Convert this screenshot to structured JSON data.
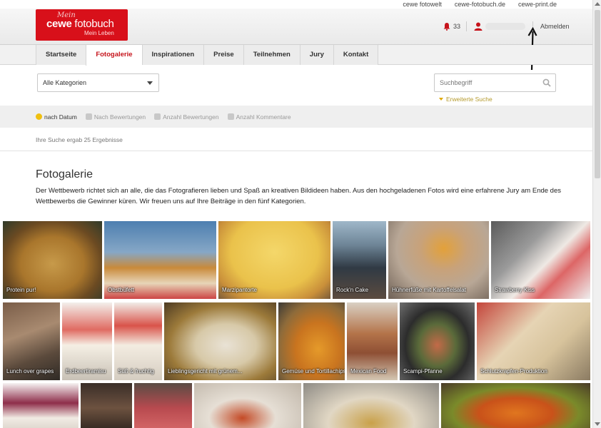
{
  "toplinks": [
    "cewe fotowelt",
    "cewe-fotobuch.de",
    "cewe-print.de"
  ],
  "logo": {
    "mein": "Mein",
    "brand_bold": "cewe",
    "brand_rest": "fotobuch",
    "sub": "Mein Leben"
  },
  "header": {
    "notification_count": "33",
    "logout": "Abmelden"
  },
  "nav": {
    "items": [
      "Startseite",
      "Fotogalerie",
      "Inspirationen",
      "Preise",
      "Teilnehmen",
      "Jury",
      "Kontakt"
    ],
    "active": "Fotogalerie"
  },
  "filter": {
    "category": "Alle Kategorien",
    "search_placeholder": "Suchbegriff",
    "advanced": "Erweiterte Suche"
  },
  "sort": [
    "nach Datum",
    "Nach Bewertungen",
    "Anzahl Bewertungen",
    "Anzahl Kommentare"
  ],
  "results_text": "Ihre Suche ergab 25 Ergebnisse",
  "page_title": "Fotogalerie",
  "intro": "Der Wettbewerb richtet sich an alle, die das Fotografieren lieben und Spaß an kreativen Bildideen haben. Aus den hochgeladenen Fotos wird eine erfahrene Jury am Ende des Wettbewerbs die Gewinner küren. Wir freuen uns auf Ihre Beiträge in den fünf Kategorien.",
  "gallery": {
    "row1": [
      "Protein pur!",
      "Obstbüfett",
      "Marzipantorte",
      "Rock'n Cake",
      "Hühnerfüße mit Kartoffelsalat",
      "Strawberry Kiss"
    ],
    "row2": [
      "Lunch over grapes",
      "Erdbeertiramisu",
      "Süß & fruchtig",
      "Lieblingsgericht mit grünem...",
      "Gemüse und Tortillachips",
      "Mexican Food",
      "Scampi-Pfanne",
      "Schlutzkrapfen-Produktion"
    ],
    "row3": [
      "",
      "",
      "",
      "",
      "",
      ""
    ]
  },
  "colors": {
    "brand_red": "#d8101a",
    "active_tab": "#c6131b"
  }
}
